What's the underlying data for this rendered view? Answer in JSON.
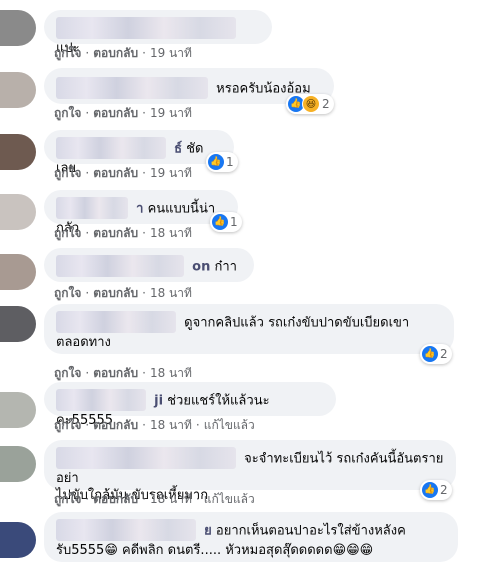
{
  "actions": {
    "like": "ถูกใจ",
    "reply": "ตอบกลับ",
    "edited": "แก้ไขแล้ว",
    "sep": "·"
  },
  "comments": [
    {
      "name_tail": "",
      "text": "แปะ",
      "time": "19 นาที",
      "edited": false,
      "reactions": null
    },
    {
      "name_tail": "",
      "text": "หรอครับน้องอ้อม",
      "time": "19 นาที",
      "edited": false,
      "reactions": {
        "types": [
          "like-icon",
          "haha-icon"
        ],
        "count": "2"
      }
    },
    {
      "name_tail": "ธ์",
      "text": "ชัดเลย",
      "time": "19 นาที",
      "edited": false,
      "reactions": {
        "types": [
          "like-icon"
        ],
        "count": "1"
      }
    },
    {
      "name_tail": "า",
      "text": "คนแบบนี้น่ากลัว",
      "time": "18 นาที",
      "edited": false,
      "reactions": {
        "types": [
          "like-icon"
        ],
        "count": "1"
      }
    },
    {
      "name_tail": "on",
      "text": "ก๋าา",
      "time": "18 นาที",
      "edited": false,
      "reactions": null
    },
    {
      "name_tail": "",
      "text": "ดูจากคลิปแล้ว รถเก๋งขับปาดขับเบียดเขา",
      "text2": "ตลอดทาง",
      "time": "18 นาที",
      "edited": false,
      "reactions": {
        "types": [
          "like-icon"
        ],
        "count": "2"
      }
    },
    {
      "name_tail": "ji",
      "text": "ช่วยแชร์ให้แล้วนะคะ55555",
      "time": "18 นาที",
      "edited": true,
      "reactions": null
    },
    {
      "name_tail": "",
      "text": "จะจำทะเบียนไว้ รถเก๋งคันนี้อันตราย อย่า",
      "text2": "ไปขับใกล้มัน ขับรถเหี้ยมาก",
      "time": "18 นาที",
      "edited": true,
      "reactions": {
        "types": [
          "like-icon"
        ],
        "count": "2"
      }
    },
    {
      "name_tail": "ย",
      "text": "อยากเห็นตอนปาอะไรใส่ข้างหลังค",
      "text2": "รับ5555😁 คดีพลิก ดนตรี..... หัวหมอสุดสุ๊ดดดดด😁😁😁",
      "time": "",
      "edited": false,
      "reactions": null
    }
  ],
  "colors": {
    "like": "#1877f2",
    "haha": "#f7b125",
    "bubble": "#f0f2f5",
    "meta": "#65676b"
  }
}
